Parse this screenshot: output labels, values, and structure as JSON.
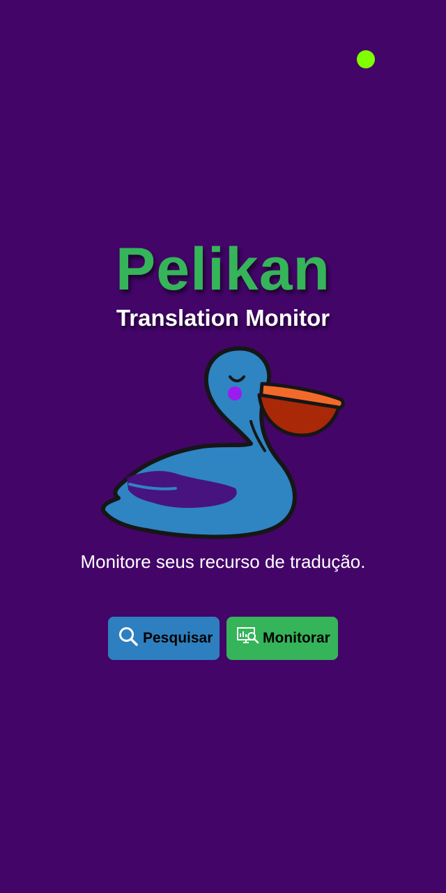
{
  "status": {
    "indicator_color": "#7fff00"
  },
  "app": {
    "title": "Pelikan",
    "subtitle": "Translation Monitor",
    "tagline": "Monitore seus recurso de tradução.",
    "mascot_icon": "pelican-mascot",
    "colors": {
      "background": "#430568",
      "title": "#35b45a",
      "search_button": "#2e7fbf",
      "monitor_button": "#35b45a"
    }
  },
  "actions": {
    "search": {
      "label": "Pesquisar",
      "icon": "search-icon"
    },
    "monitor": {
      "label": "Monitorar",
      "icon": "monitor-analytics-icon"
    }
  }
}
